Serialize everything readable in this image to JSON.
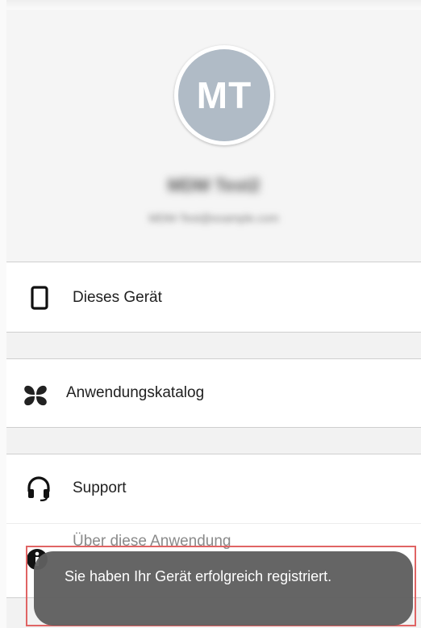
{
  "profile": {
    "initials": "MT",
    "avatar_color": "#b0bbc6",
    "name": "MDM Test2",
    "email": "MDM-Test@example.com"
  },
  "menu": {
    "items": [
      {
        "label": "Dieses Gerät",
        "icon": "smartphone-icon"
      },
      {
        "label": "Anwendungskatalog",
        "icon": "app-catalog-icon"
      },
      {
        "label": "Support",
        "icon": "headset-icon"
      },
      {
        "label": "Über diese Anwendung",
        "icon": "info-icon"
      }
    ]
  },
  "toast": {
    "message": "Sie haben Ihr Gerät erfolgreich registriert."
  },
  "colors": {
    "highlight": "#e06464",
    "toast_bg": "#5f5f5f"
  }
}
